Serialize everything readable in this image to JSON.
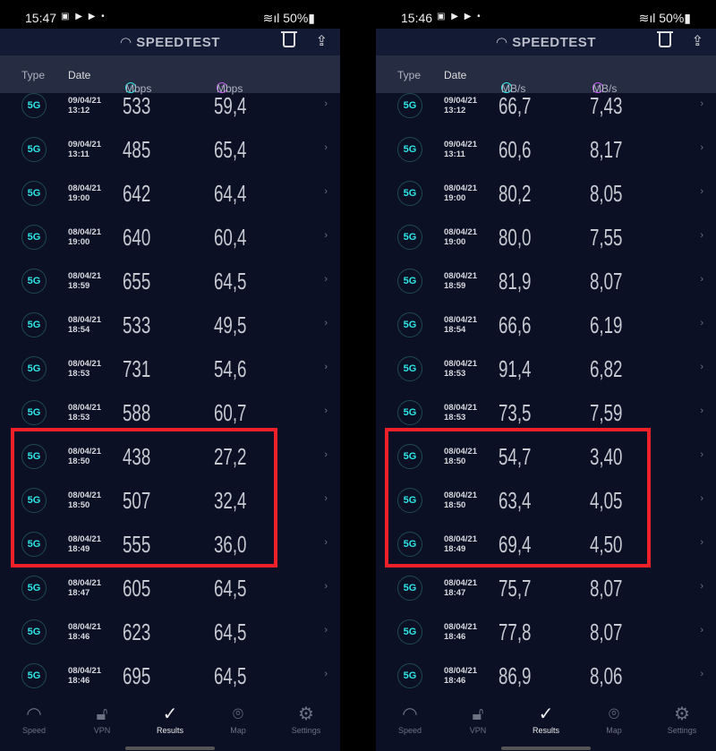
{
  "colors": {
    "accent_download": "#2ee6e6",
    "accent_upload": "#c35cf0",
    "highlight": "#ee2028",
    "background": "#0b1024"
  },
  "panels": [
    {
      "status": {
        "time": "15:47",
        "battery": "50%"
      },
      "header": {
        "title": "SPEEDTEST"
      },
      "columns": {
        "type": "Type",
        "date": "Date",
        "download": "Mbps",
        "upload": "Mbps"
      },
      "rows": [
        {
          "type": "5G",
          "date": "09/04/21",
          "time": "13:12",
          "download": "533",
          "upload": "59,4"
        },
        {
          "type": "5G",
          "date": "09/04/21",
          "time": "13:11",
          "download": "485",
          "upload": "65,4"
        },
        {
          "type": "5G",
          "date": "08/04/21",
          "time": "19:00",
          "download": "642",
          "upload": "64,4"
        },
        {
          "type": "5G",
          "date": "08/04/21",
          "time": "19:00",
          "download": "640",
          "upload": "60,4"
        },
        {
          "type": "5G",
          "date": "08/04/21",
          "time": "18:59",
          "download": "655",
          "upload": "64,5"
        },
        {
          "type": "5G",
          "date": "08/04/21",
          "time": "18:54",
          "download": "533",
          "upload": "49,5"
        },
        {
          "type": "5G",
          "date": "08/04/21",
          "time": "18:53",
          "download": "731",
          "upload": "54,6"
        },
        {
          "type": "5G",
          "date": "08/04/21",
          "time": "18:53",
          "download": "588",
          "upload": "60,7"
        },
        {
          "type": "5G",
          "date": "08/04/21",
          "time": "18:50",
          "download": "438",
          "upload": "27,2"
        },
        {
          "type": "5G",
          "date": "08/04/21",
          "time": "18:50",
          "download": "507",
          "upload": "32,4"
        },
        {
          "type": "5G",
          "date": "08/04/21",
          "time": "18:49",
          "download": "555",
          "upload": "36,0"
        },
        {
          "type": "5G",
          "date": "08/04/21",
          "time": "18:47",
          "download": "605",
          "upload": "64,5"
        },
        {
          "type": "5G",
          "date": "08/04/21",
          "time": "18:46",
          "download": "623",
          "upload": "64,5"
        },
        {
          "type": "5G",
          "date": "08/04/21",
          "time": "18:46",
          "download": "695",
          "upload": "64,5"
        }
      ]
    },
    {
      "status": {
        "time": "15:46",
        "battery": "50%"
      },
      "header": {
        "title": "SPEEDTEST"
      },
      "columns": {
        "type": "Type",
        "date": "Date",
        "download": "MB/s",
        "upload": "MB/s"
      },
      "rows": [
        {
          "type": "5G",
          "date": "09/04/21",
          "time": "13:12",
          "download": "66,7",
          "upload": "7,43"
        },
        {
          "type": "5G",
          "date": "09/04/21",
          "time": "13:11",
          "download": "60,6",
          "upload": "8,17"
        },
        {
          "type": "5G",
          "date": "08/04/21",
          "time": "19:00",
          "download": "80,2",
          "upload": "8,05"
        },
        {
          "type": "5G",
          "date": "08/04/21",
          "time": "19:00",
          "download": "80,0",
          "upload": "7,55"
        },
        {
          "type": "5G",
          "date": "08/04/21",
          "time": "18:59",
          "download": "81,9",
          "upload": "8,07"
        },
        {
          "type": "5G",
          "date": "08/04/21",
          "time": "18:54",
          "download": "66,6",
          "upload": "6,19"
        },
        {
          "type": "5G",
          "date": "08/04/21",
          "time": "18:53",
          "download": "91,4",
          "upload": "6,82"
        },
        {
          "type": "5G",
          "date": "08/04/21",
          "time": "18:53",
          "download": "73,5",
          "upload": "7,59"
        },
        {
          "type": "5G",
          "date": "08/04/21",
          "time": "18:50",
          "download": "54,7",
          "upload": "3,40"
        },
        {
          "type": "5G",
          "date": "08/04/21",
          "time": "18:50",
          "download": "63,4",
          "upload": "4,05"
        },
        {
          "type": "5G",
          "date": "08/04/21",
          "time": "18:49",
          "download": "69,4",
          "upload": "4,50"
        },
        {
          "type": "5G",
          "date": "08/04/21",
          "time": "18:47",
          "download": "75,7",
          "upload": "8,07"
        },
        {
          "type": "5G",
          "date": "08/04/21",
          "time": "18:46",
          "download": "77,8",
          "upload": "8,07"
        },
        {
          "type": "5G",
          "date": "08/04/21",
          "time": "18:46",
          "download": "86,9",
          "upload": "8,06"
        }
      ]
    }
  ],
  "highlighted_rows": [
    8,
    9,
    10
  ],
  "nav": [
    {
      "label": "Speed",
      "icon": "speedometer-icon",
      "glyph": "◠",
      "active": false
    },
    {
      "label": "VPN",
      "icon": "unlock-icon",
      "glyph": "🔓︎",
      "active": false
    },
    {
      "label": "Results",
      "icon": "check-circle-icon",
      "glyph": "✓",
      "active": true
    },
    {
      "label": "Map",
      "icon": "map-pin-icon",
      "glyph": "⌾",
      "active": false
    },
    {
      "label": "Settings",
      "icon": "gear-icon",
      "glyph": "⚙",
      "active": false
    }
  ]
}
